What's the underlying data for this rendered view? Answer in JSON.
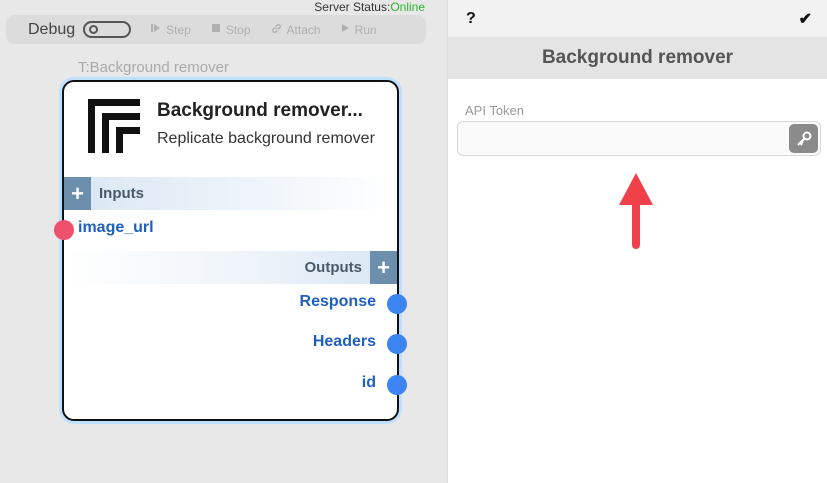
{
  "server_status": {
    "label": "Server Status:",
    "value": "Online",
    "value_color": "#2eb82e"
  },
  "toolbar": {
    "debug_label": "Debug",
    "debug_enabled": false,
    "buttons": [
      {
        "label": "Step",
        "icon": "step-icon"
      },
      {
        "label": "Stop",
        "icon": "stop-icon"
      },
      {
        "label": "Attach",
        "icon": "link-icon"
      },
      {
        "label": "Run",
        "icon": "play-icon"
      }
    ]
  },
  "node": {
    "caption": "T:Background remover",
    "title": "Background remover...",
    "description": "Replicate background remover",
    "inputs_label": "Inputs",
    "outputs_label": "Outputs",
    "inputs": [
      {
        "label": "image_url",
        "color": "#f0506e"
      }
    ],
    "outputs": [
      {
        "label": "Response",
        "color": "#3d85f5"
      },
      {
        "label": "Headers",
        "color": "#3d85f5"
      },
      {
        "label": "id",
        "color": "#3d85f5"
      }
    ]
  },
  "panel": {
    "help_label": "?",
    "confirm_label": "✔",
    "title": "Background remover",
    "field_label": "API Token",
    "field_value": "",
    "field_placeholder": "",
    "key_icon": "key-icon",
    "annotation_color": "#f0404a"
  }
}
